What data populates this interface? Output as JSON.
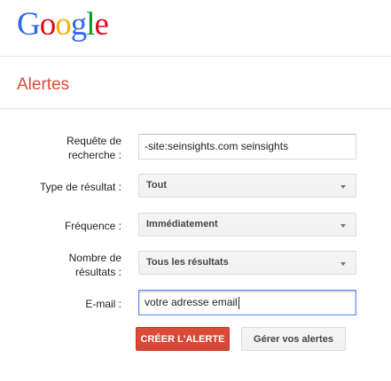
{
  "logo": {
    "letters": [
      {
        "char": "G",
        "color": "#3369e8"
      },
      {
        "char": "o",
        "color": "#d50f25"
      },
      {
        "char": "o",
        "color": "#eeb211"
      },
      {
        "char": "g",
        "color": "#3369e8"
      },
      {
        "char": "l",
        "color": "#009925"
      },
      {
        "char": "e",
        "color": "#d50f25"
      }
    ]
  },
  "page": {
    "title": "Alertes"
  },
  "form": {
    "query": {
      "label_line1": "Requête de",
      "label_line2": "recherche :",
      "value": "-site:seinsights.com seinsights"
    },
    "result_type": {
      "label": "Type de résultat :",
      "value": "Tout"
    },
    "frequency": {
      "label": "Fréquence :",
      "value": "Immédiatement"
    },
    "count": {
      "label_line1": "Nombre de",
      "label_line2": "résultats :",
      "value": "Tous les résultats"
    },
    "email": {
      "label": "E-mail :",
      "value": "votre adresse email"
    }
  },
  "actions": {
    "create_label": "CRÉER L'ALERTE",
    "manage_label": "Gérer vos alertes"
  },
  "colors": {
    "accent_red": "#dd4b39",
    "focus_blue": "#4d90fe"
  }
}
